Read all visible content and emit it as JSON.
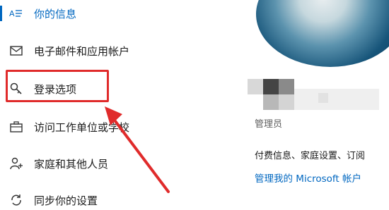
{
  "sidebar": {
    "items": [
      {
        "label": "你的信息",
        "icon": "person-card-icon",
        "active": true
      },
      {
        "label": "电子邮件和应用帐户",
        "icon": "mail-icon",
        "active": false
      },
      {
        "label": "登录选项",
        "icon": "key-icon",
        "active": false
      },
      {
        "label": "访问工作单位或学校",
        "icon": "briefcase-icon",
        "active": false
      },
      {
        "label": "家庭和其他人员",
        "icon": "person-add-icon",
        "active": false
      },
      {
        "label": "同步你的设置",
        "icon": "sync-icon",
        "active": false
      }
    ]
  },
  "main": {
    "role": "管理员",
    "billing_text": "付费信息、家庭设置、订阅",
    "manage_link": "管理我的 Microsoft 帐户"
  },
  "colors": {
    "accent": "#0067c0",
    "highlight": "#e02b2b"
  }
}
